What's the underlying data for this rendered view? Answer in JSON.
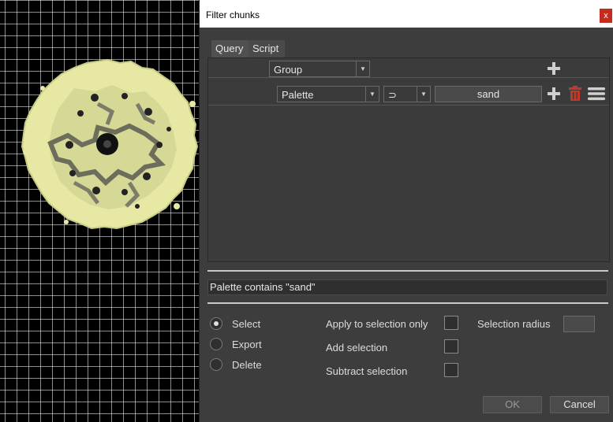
{
  "dialog": {
    "title": "Filter chunks",
    "close_label": "x"
  },
  "tabs": [
    {
      "label": "Query",
      "active": true
    },
    {
      "label": "Script",
      "active": false
    }
  ],
  "query": {
    "group_row": {
      "combo_value": "Group"
    },
    "condition_row": {
      "field_value": "Palette",
      "operator_value": "⊃",
      "value": "sand"
    }
  },
  "expression": "Palette contains \"sand\"",
  "actions": {
    "options": [
      {
        "label": "Select",
        "selected": true
      },
      {
        "label": "Export",
        "selected": false
      },
      {
        "label": "Delete",
        "selected": false
      }
    ]
  },
  "options": {
    "apply_selection_only": "Apply to selection only",
    "add_selection": "Add selection",
    "subtract_selection": "Subtract selection",
    "selection_radius": "Selection radius"
  },
  "buttons": {
    "ok": "OK",
    "cancel": "Cancel"
  },
  "colors": {
    "terrain": "#e6e8a4",
    "delete_icon": "#c0392b",
    "dialog_bg": "#3d3d3d"
  }
}
